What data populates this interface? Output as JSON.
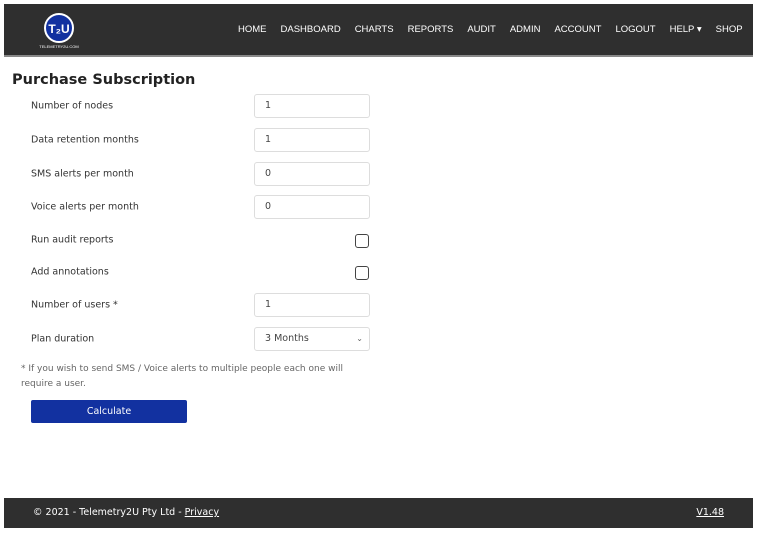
{
  "brand": {
    "logo_text": "T2U",
    "logo_ring": "TELEMETRY2U.COM",
    "accent": "#1231a0"
  },
  "nav": [
    "HOME",
    "DASHBOARD",
    "CHARTS",
    "REPORTS",
    "AUDIT",
    "ADMIN",
    "ACCOUNT",
    "LOGOUT",
    "HELP ▾",
    "SHOP"
  ],
  "title": "Purchase Subscription",
  "form": {
    "nodes": {
      "label": "Number of nodes",
      "value": "1"
    },
    "retention": {
      "label": "Data retention months",
      "value": "1"
    },
    "sms": {
      "label": "SMS alerts per month",
      "value": "0"
    },
    "voice": {
      "label": "Voice alerts per month",
      "value": "0"
    },
    "audit": {
      "label": "Run audit reports",
      "checked": false
    },
    "annotations": {
      "label": "Add annotations",
      "checked": false
    },
    "users": {
      "label": "Number of users *",
      "value": "1"
    },
    "duration": {
      "label": "Plan duration",
      "value": "3 Months"
    }
  },
  "note": "* If you wish to send SMS / Voice alerts to multiple people each one will require a user.",
  "calculate": "Calculate",
  "footer": {
    "copyright": "© 2021 - Telemetry2U Pty Ltd - ",
    "privacy": "Privacy",
    "version": "V1.48"
  }
}
